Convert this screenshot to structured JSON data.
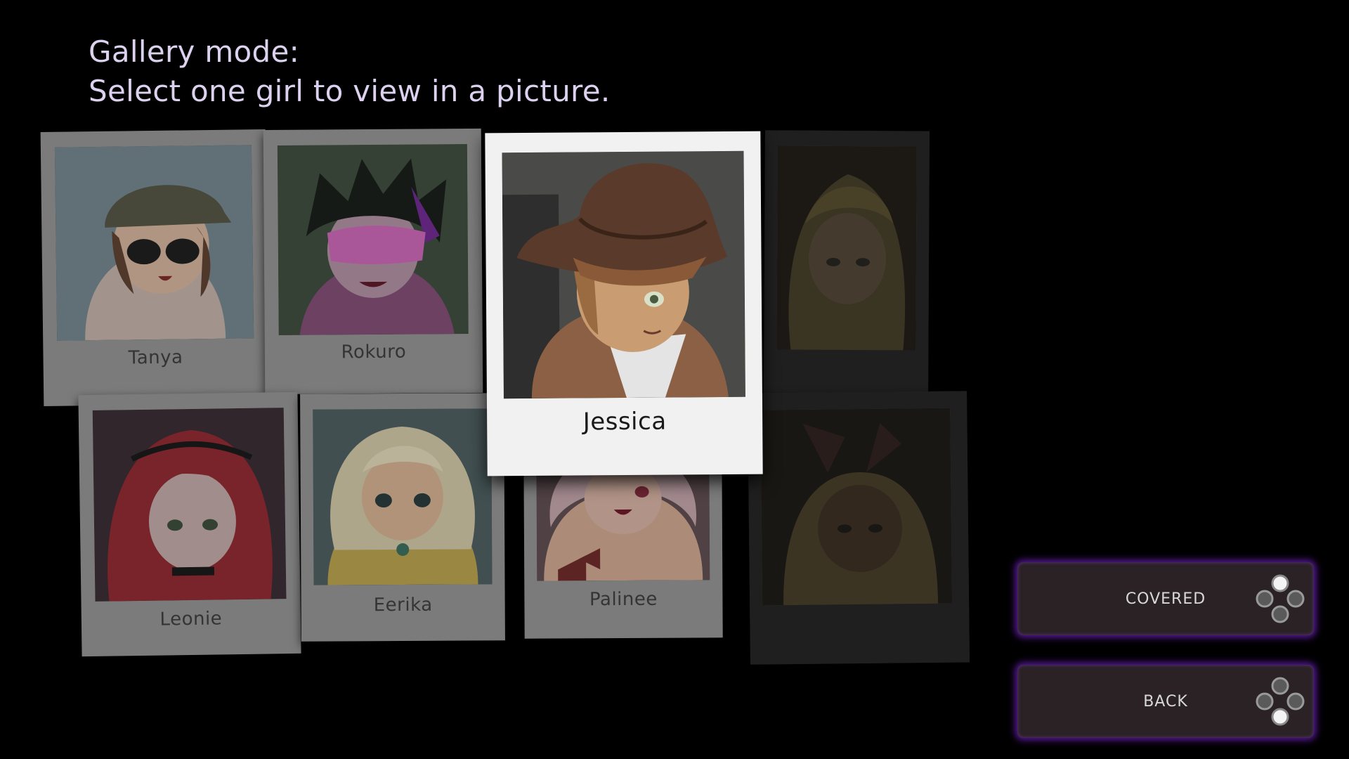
{
  "instructions": {
    "line1": "Gallery mode:",
    "line2": "Select one girl to view in a picture."
  },
  "gallery": {
    "selected": "Jessica",
    "cards": [
      {
        "id": "tanya",
        "name": "Tanya",
        "state": "dim"
      },
      {
        "id": "rokuro",
        "name": "Rokuro",
        "state": "dim"
      },
      {
        "id": "jessica",
        "name": "Jessica",
        "state": "selected"
      },
      {
        "id": "locked-1",
        "name": "",
        "state": "locked"
      },
      {
        "id": "leonie",
        "name": "Leonie",
        "state": "dim"
      },
      {
        "id": "eerika",
        "name": "Eerika",
        "state": "dim"
      },
      {
        "id": "palinee",
        "name": "Palinee",
        "state": "dim"
      },
      {
        "id": "locked-2",
        "name": "",
        "state": "locked"
      }
    ]
  },
  "menu": {
    "covered_label": "COVERED",
    "back_label": "BACK",
    "button_icon": "gamepad-face-buttons-icon"
  },
  "colors": {
    "background": "#000000",
    "instruction_text": "#dcd2f0",
    "button_glow": "#5b1aa0",
    "button_fill": "#2a2224"
  }
}
